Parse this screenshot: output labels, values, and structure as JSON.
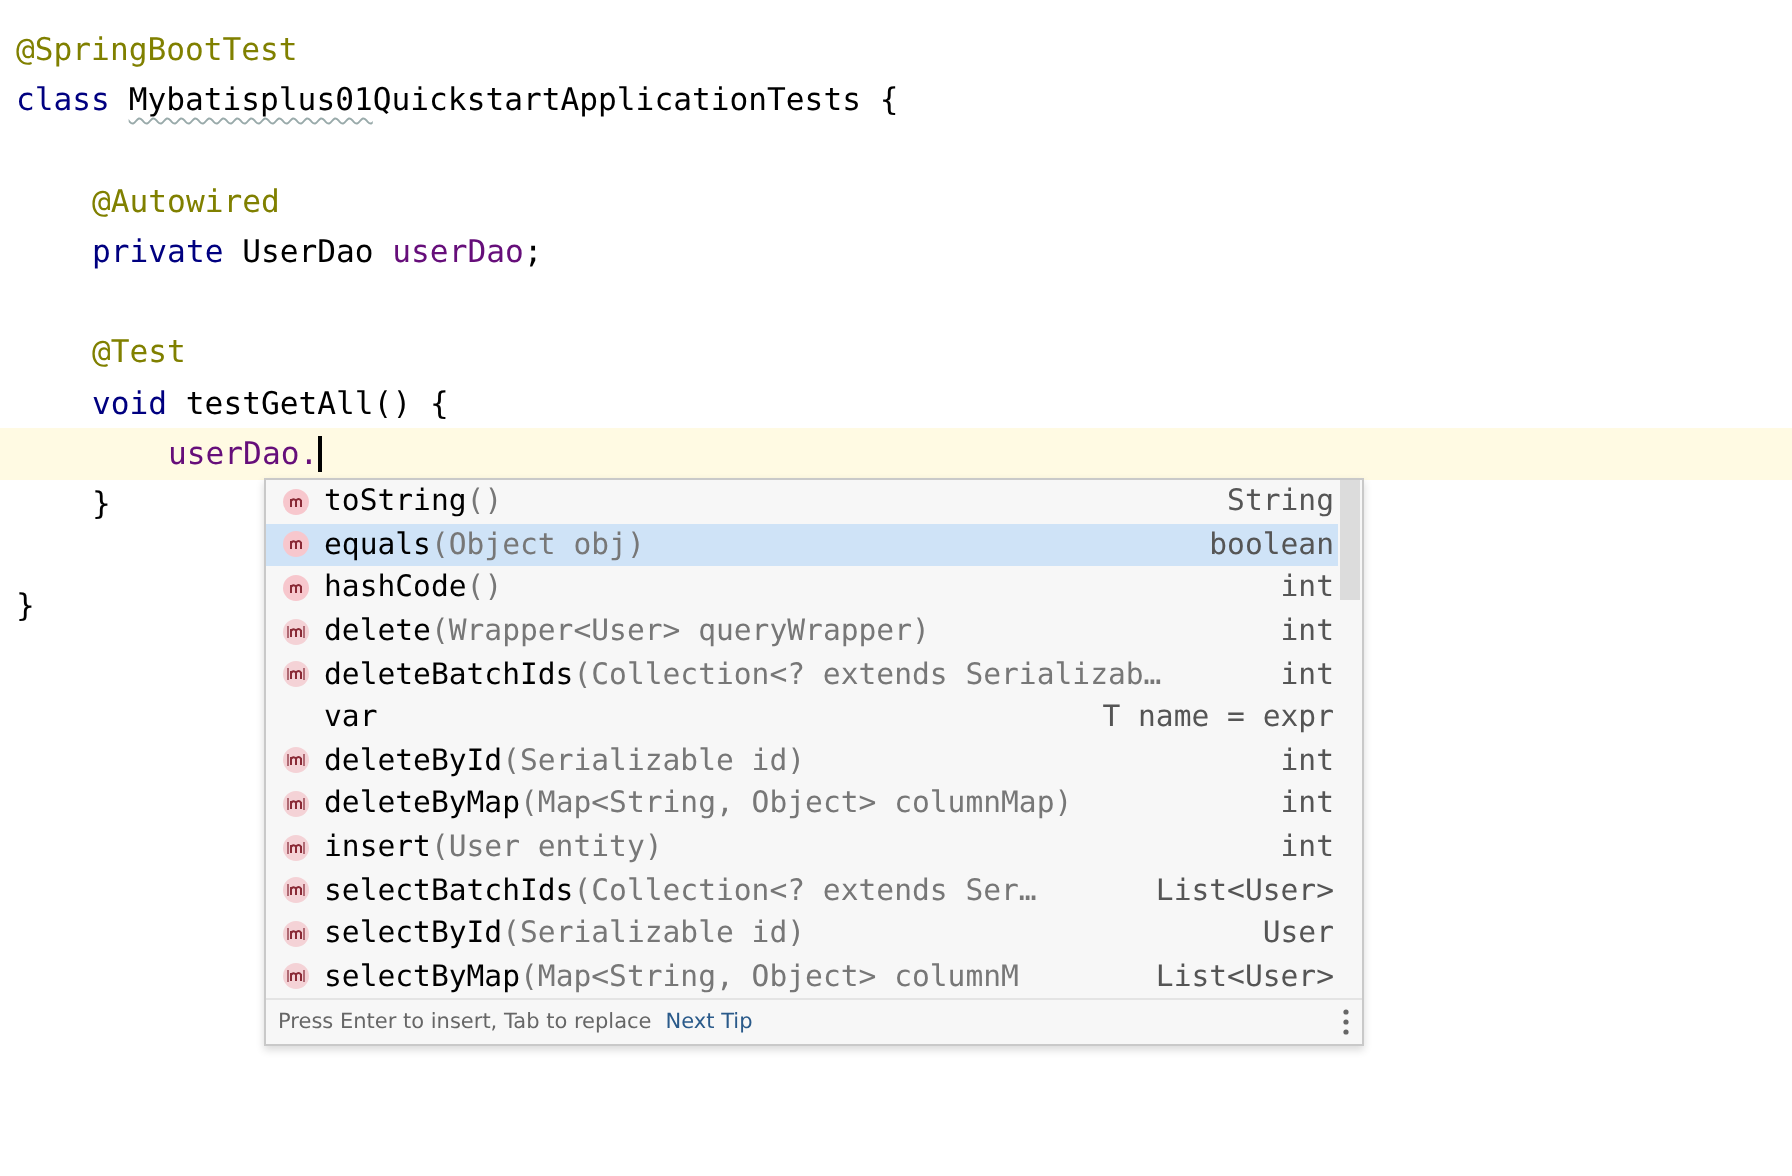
{
  "editor": {
    "lines": [
      {
        "kind": "code",
        "tokens": [
          {
            "kind": "annotation",
            "text": "@SpringBootTest"
          }
        ]
      },
      {
        "kind": "code",
        "tokens": [
          {
            "kind": "keyword",
            "text": "class"
          },
          {
            "kind": "typo",
            "text": "Mybatisplus01"
          },
          {
            "kind": "plain",
            "text": "QuickstartApplicationTests {"
          }
        ],
        "children": [
          {
            "kind": "blank"
          },
          {
            "kind": "code",
            "tokens": [
              {
                "kind": "annotation",
                "text": "@Autowired"
              }
            ]
          },
          {
            "kind": "code",
            "tokens": [
              {
                "kind": "keyword",
                "text": "private"
              },
              {
                "kind": "plain",
                "text": "UserDao"
              },
              {
                "kind": "field",
                "text": "userDao"
              },
              {
                "kind": "plain",
                "text": ";"
              }
            ]
          },
          {
            "kind": "blank"
          },
          {
            "kind": "code",
            "tokens": [
              {
                "kind": "annotation",
                "text": "@Test"
              }
            ]
          },
          {
            "kind": "code",
            "tokens": [
              {
                "kind": "keyword",
                "text": "void"
              },
              {
                "kind": "plain",
                "text": "testGetAll() {"
              }
            ],
            "children": [
              {
                "kind": "code",
                "current": true,
                "tokens": [
                  {
                    "kind": "field",
                    "text": "userDao."
                  }
                ]
              }
            ]
          },
          {
            "kind": "code",
            "tokens": [
              {
                "kind": "plain",
                "text": "}"
              }
            ]
          }
        ]
      },
      {
        "kind": "blank"
      },
      {
        "kind": "code",
        "tokens": [
          {
            "kind": "plain",
            "text": "}"
          }
        ]
      }
    ]
  },
  "completion": {
    "items": [
      {
        "kind": "method",
        "name": "toString",
        "params": "()",
        "type": "String",
        "selected": false
      },
      {
        "kind": "method",
        "name": "equals",
        "params": "(Object obj)",
        "type": "boolean",
        "selected": true
      },
      {
        "kind": "method",
        "name": "hashCode",
        "params": "()",
        "type": "int",
        "selected": false
      },
      {
        "kind": "mapper_method",
        "name": "delete",
        "params": "(Wrapper<User> queryWrapper)",
        "type": "int",
        "selected": false
      },
      {
        "kind": "mapper_method",
        "name": "deleteBatchIds",
        "params": "(Collection<? extends Serializab…",
        "type": "int",
        "selected": false
      },
      {
        "kind": "template",
        "name": "var",
        "type": "T name = expr",
        "selected": false
      },
      {
        "kind": "mapper_method",
        "name": "deleteById",
        "params": "(Serializable id)",
        "type": "int",
        "selected": false
      },
      {
        "kind": "mapper_method",
        "name": "deleteByMap",
        "params": "(Map<String, Object> columnMap)",
        "type": "int",
        "selected": false
      },
      {
        "kind": "mapper_method",
        "name": "insert",
        "params": "(User entity)",
        "type": "int",
        "selected": false
      },
      {
        "kind": "mapper_method",
        "name": "selectBatchIds",
        "params": "(Collection<? extends Ser…",
        "type": "List<User>",
        "selected": false
      },
      {
        "kind": "mapper_method",
        "name": "selectById",
        "params": "(Serializable id)",
        "type": "User",
        "selected": false
      },
      {
        "kind": "mapper_method",
        "name": "selectByMap",
        "params": "(Map<String, Object> columnM",
        "type": "List<User>",
        "selected": false
      }
    ],
    "hint": "Press Enter to insert, Tab to replace",
    "link": "Next Tip"
  }
}
